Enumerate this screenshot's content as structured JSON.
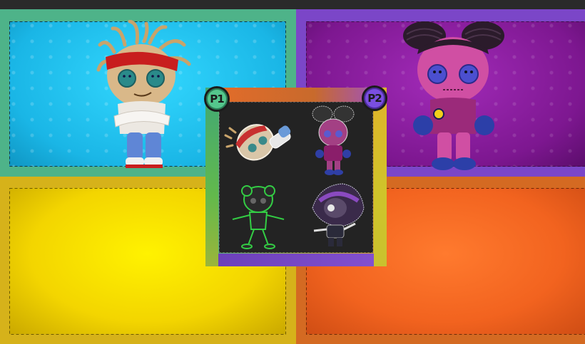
{
  "players": {
    "p1": {
      "label": "P1",
      "color": "#54c68c",
      "panel_color": "#1ab6e6"
    },
    "p2": {
      "label": "P2",
      "color": "#7a4fe0",
      "panel_color": "#7d1790"
    }
  },
  "panels": {
    "top_left": {
      "color": "#33d8ff",
      "occupant": "sackboy-headband-fighter"
    },
    "top_right": {
      "color": "#a22bb9",
      "occupant": "pink-braided-fighter"
    },
    "bottom_left": {
      "color": "#fff200",
      "occupant": ""
    },
    "bottom_right": {
      "color": "#ff7a2e",
      "occupant": ""
    }
  },
  "roster": [
    {
      "id": "headband-fighter",
      "icon": "headband-fighter-icon",
      "outline": "#e8e0d0"
    },
    {
      "id": "braided-fighter",
      "icon": "braided-fighter-icon",
      "outline": "#c04aa0"
    },
    {
      "id": "green-outline-fighter",
      "icon": "green-outline-fighter-icon",
      "outline": "#33cc44"
    },
    {
      "id": "hooded-fighter",
      "icon": "hooded-fighter-icon",
      "outline": "#8a4ac0"
    }
  ]
}
